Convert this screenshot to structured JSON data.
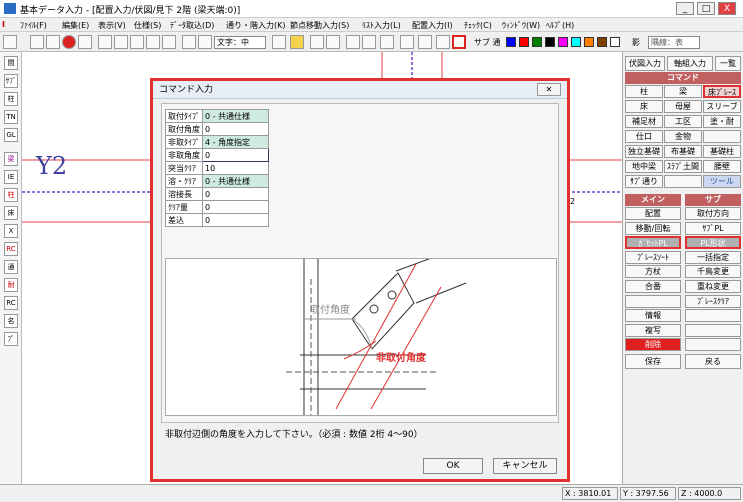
{
  "window": {
    "title": "基本データ入力 - [配置入力/伏図/見下 2階 (梁天端:0)]",
    "minimize": "_",
    "maximize": "□",
    "close": "X"
  },
  "menu": [
    "ﾌｧｲﾙ(F)",
    "編集(E)",
    "表示(V)",
    "仕様(S)",
    "ﾃﾞｰﾀ取込(D)",
    "通り・階入力(K)",
    "節点移動入力(S)",
    "ﾘｽﾄ入力(L)",
    "配置入力(I)",
    "ﾁｪｯｸ(C)",
    "ｳｨﾝﾄﾞｳ(W)",
    "ﾍﾙﾌﾟ(H)"
  ],
  "toolbar": {
    "font_label": "文字：中",
    "sub_label": "サブ 通",
    "line_select": "隅線：表",
    "shadow_label": "影",
    "colors": [
      "#0000ff",
      "#ff0000",
      "#008000",
      "#000000",
      "#ff00ff",
      "#00ffff",
      "#ff8000",
      "#804000",
      "#ffffff"
    ]
  },
  "left_tools": [
    "間",
    "ｻﾌﾞ",
    "柱",
    "TN",
    "GL",
    "梁",
    "IE",
    "柱",
    "床",
    "X",
    "RC",
    "通",
    "耐",
    "RC",
    "名",
    "ﾌﾟ"
  ],
  "canvas": {
    "grid_label": "Y2",
    "marker_left": "2",
    "marker_right": "2"
  },
  "right_panel": {
    "tabs": [
      "伏図入力",
      "軸組入力",
      "一覧"
    ],
    "command_header": "コマンド",
    "command_buttons": [
      "柱",
      "梁",
      "床ﾌﾞﾚｰｽ",
      "床",
      "母屋",
      "スリーブ",
      "補足材",
      "工区",
      "塗・耐",
      "仕口",
      "金物",
      "",
      "独立基礎",
      "布基礎",
      "基礎柱",
      "地中梁",
      "ｽﾗﾌﾞ土間",
      "腰壁",
      "ｻﾌﾞ通り",
      "",
      "ツール"
    ],
    "main_header": "メイン",
    "sub_header": "サブ",
    "main_buttons": [
      "配置",
      "移動/回転",
      "ｶﾞｾｯﾄPL",
      "ﾌﾞﾚｰｽｿｰﾄ",
      "方杖",
      "合番",
      "",
      "情報",
      "複写",
      "削除"
    ],
    "sub_buttons": [
      "取付方向",
      "ｻﾌﾞPL",
      "PL形状",
      "一括指定",
      "千鳥変更",
      "重ね変更",
      "ﾌﾞﾚｰｽｸﾘｱ",
      "",
      "",
      ""
    ],
    "save": "保存",
    "back": "戻る"
  },
  "status": {
    "x": "X : 3810.01",
    "y": "Y : 3797.56",
    "z": "Z : 4000.0"
  },
  "dialog": {
    "title": "コマンド入力",
    "close": "✕",
    "rows": [
      {
        "key": "取付ﾀｲﾌﾟ",
        "value": "0 - 共通仕様"
      },
      {
        "key": "取付角度",
        "value": "0"
      },
      {
        "key": "非取ﾀｲﾌﾟ",
        "value": "4 - 角度指定"
      },
      {
        "key": "非取角度",
        "value": "0"
      },
      {
        "key": "突当ｸﾘｱ",
        "value": "10"
      },
      {
        "key": "溶・ｸﾘｱ",
        "value": "0 - 共通仕様"
      },
      {
        "key": "溶接長",
        "value": "0"
      },
      {
        "key": "ｸﾘｱ量",
        "value": "0"
      },
      {
        "key": "差込",
        "value": "0"
      }
    ],
    "diagram_label_attach": "取付角度",
    "diagram_label_nonattach": "非取付角度",
    "message": "非取付辺側の角度を入力して下さい。（必須 : 数値 2桁 4～90）",
    "ok": "OK",
    "cancel": "キャンセル"
  }
}
